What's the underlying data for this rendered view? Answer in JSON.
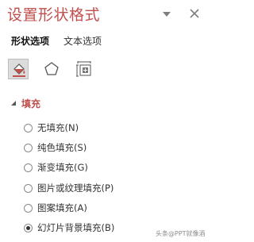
{
  "pane": {
    "title": "设置形状格式",
    "dropdown_icon": "chevron-down-icon",
    "close_icon": "close-icon"
  },
  "tabs": [
    {
      "label": "形状选项",
      "active": true
    },
    {
      "label": "文本选项",
      "active": false
    }
  ],
  "category_icons": [
    {
      "icon": "fill-line-icon",
      "selected": true
    },
    {
      "icon": "effects-pentagon-icon",
      "selected": false
    },
    {
      "icon": "size-properties-icon",
      "selected": false
    }
  ],
  "fill_section": {
    "label": "填充",
    "expanded": true,
    "options": [
      {
        "label": "无填充(N)",
        "checked": false
      },
      {
        "label": "纯色填充(S)",
        "checked": false
      },
      {
        "label": "渐变填充(G)",
        "checked": false
      },
      {
        "label": "图片或纹理填充(P)",
        "checked": false
      },
      {
        "label": "图案填充(A)",
        "checked": false
      },
      {
        "label": "幻灯片背景填充(B)",
        "checked": true
      }
    ]
  },
  "watermark": "头条@PPT就像酒",
  "colors": {
    "accent": "#c0504d",
    "text": "#333333"
  }
}
